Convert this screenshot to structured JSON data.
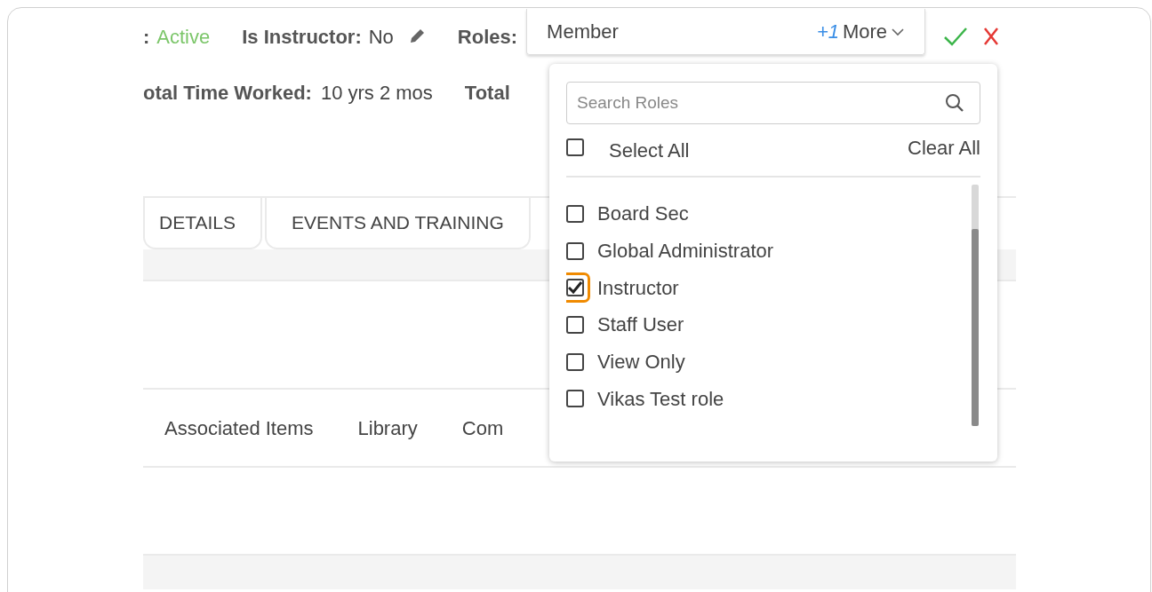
{
  "header": {
    "status": {
      "label": ":",
      "value": "Active"
    },
    "instructor": {
      "label": "Is Instructor:",
      "value": "No"
    },
    "roles": {
      "label": "Roles:",
      "value": "Member",
      "extra_count": "+1",
      "more": "More"
    },
    "time_worked": {
      "label": "otal Time Worked:",
      "value": "10 yrs 2 mos"
    },
    "total": {
      "label": "Total"
    }
  },
  "tabs": [
    {
      "label": "DETAILS",
      "selected": false
    },
    {
      "label": "EVENTS AND TRAINING",
      "selected": false
    }
  ],
  "sub_tabs": [
    {
      "label": "Associated Items"
    },
    {
      "label": "Library"
    },
    {
      "label": "Com"
    }
  ],
  "roles_dropdown": {
    "search": {
      "placeholder": "Search Roles"
    },
    "select_all": {
      "label": "Select All",
      "checked": false
    },
    "clear_all": "Clear All",
    "items": [
      {
        "label": "Board Sec",
        "checked": false,
        "highlighted": false
      },
      {
        "label": "Global Administrator",
        "checked": false,
        "highlighted": false
      },
      {
        "label": "Instructor",
        "checked": true,
        "highlighted": true
      },
      {
        "label": "Staff User",
        "checked": false,
        "highlighted": false
      },
      {
        "label": "View Only",
        "checked": false,
        "highlighted": false
      },
      {
        "label": "Vikas Test role",
        "checked": false,
        "highlighted": false
      }
    ]
  }
}
